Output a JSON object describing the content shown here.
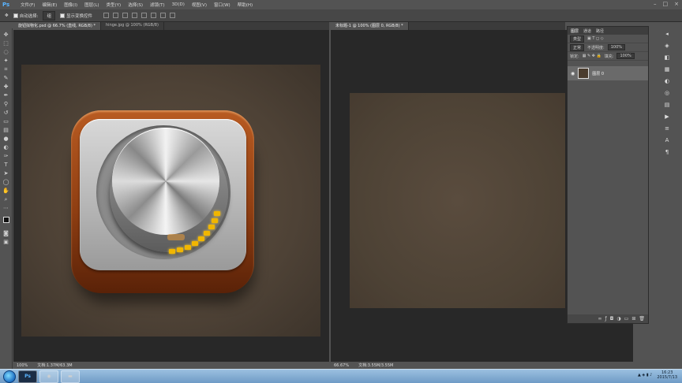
{
  "app": {
    "logo": "Ps"
  },
  "menu": [
    "文件(F)",
    "编辑(E)",
    "图像(I)",
    "图层(L)",
    "类型(Y)",
    "选择(S)",
    "滤镜(T)",
    "3D(D)",
    "视图(V)",
    "窗口(W)",
    "帮助(H)"
  ],
  "window_controls": {
    "minimize": "–",
    "maximize": "□",
    "close": "×"
  },
  "options": {
    "auto_select_label": "自动选择:",
    "auto_select_value": "组",
    "transform_label": "显示变换控件"
  },
  "tabs_left": [
    {
      "label": "旋钮拟物化.psd @ 66.7% (直线, RGB/8) *",
      "active": true
    },
    {
      "label": "hinge.jpg @ 100% (RGB/8)",
      "active": false
    }
  ],
  "tabs_right": [
    {
      "label": "未标题-1 @ 100% (图层 0, RGB/8) *",
      "active": true
    }
  ],
  "status_left": {
    "zoom": "100%",
    "doc": "文档:1.37M/63.3M"
  },
  "status_right": {
    "zoom": "66.67%",
    "doc": "文档:3.55M/3.55M"
  },
  "layers_panel": {
    "tabs": [
      "图层",
      "通道",
      "路径"
    ],
    "kind_filter": "类型",
    "blend_mode": "正常",
    "opacity_label": "不透明度:",
    "opacity_value": "100%",
    "lock_label": "锁定:",
    "fill_label": "填充:",
    "fill_value": "100%",
    "layer_name": "图层 0"
  },
  "tray": {
    "time": "16:23",
    "date": "2015/7/13"
  },
  "colors": {
    "knob_led": "#f1b600",
    "wood": "#8f3e12",
    "canvas_bg": "#4e4236"
  }
}
